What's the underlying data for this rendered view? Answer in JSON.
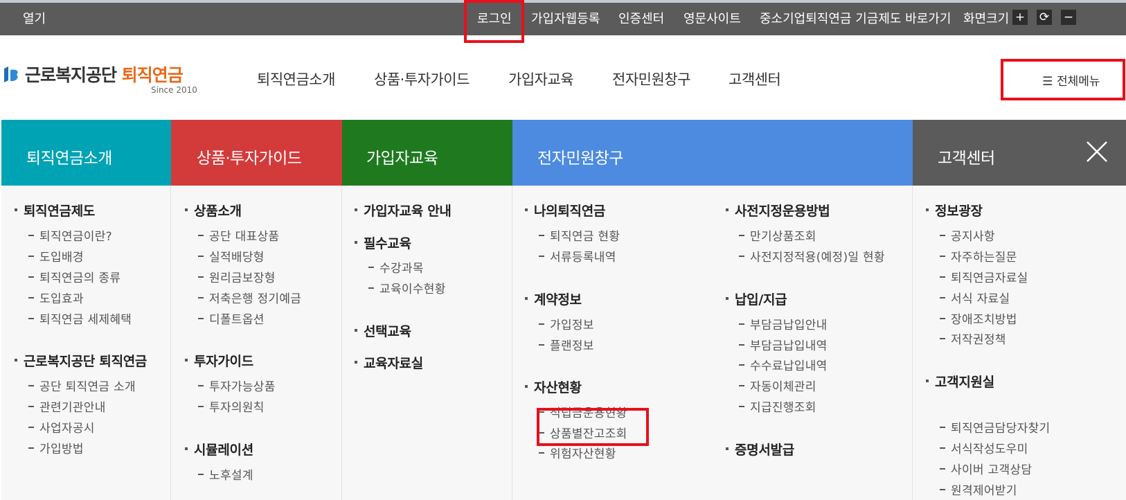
{
  "topbar": {
    "open": "열기",
    "links": [
      "로그인",
      "가입자웹등록",
      "인증센터",
      "영문사이트",
      "중소기업퇴직연금 기금제도 바로가기",
      "화면크기"
    ],
    "zoom_in": "+",
    "zoom_reset": "⟳",
    "zoom_out": "−"
  },
  "header": {
    "logo_main": "근로복지공단 ",
    "logo_accent": "퇴직연금",
    "logo_since": "Since 2010",
    "nav": [
      "퇴직연금소개",
      "상품·투자가이드",
      "가입자교육",
      "전자민원창구",
      "고객센터"
    ],
    "all_menu": "전체메뉴"
  },
  "mega": {
    "columns": [
      {
        "title": "퇴직연금소개",
        "color": "#00a3b4"
      },
      {
        "title": "상품·투자가이드",
        "color": "#d33b3b"
      },
      {
        "title": "가입자교육",
        "color": "#1f7a1f"
      },
      {
        "title": "전자민원창구",
        "color": "#4c8bdf"
      },
      {
        "title": "고객센터",
        "color": "#5b5b5b"
      }
    ],
    "intro": {
      "s1": {
        "title": "퇴직연금제도",
        "items": [
          "퇴직연금이란?",
          "도입배경",
          "퇴직연금의 종류",
          "도입효과",
          "퇴직연금 세제혜택"
        ]
      },
      "s2": {
        "title": "근로복지공단 퇴직연금",
        "items": [
          "공단 퇴직연금 소개",
          "관련기관안내",
          "사업자공시",
          "가입방법"
        ]
      }
    },
    "product": {
      "s1": {
        "title": "상품소개",
        "items": [
          "공단 대표상품",
          "실적배당형",
          "원리금보장형",
          "저축은행 정기예금",
          "디폴트옵션"
        ]
      },
      "s2": {
        "title": "투자가이드",
        "items": [
          "투자가능상품",
          "투자의원칙"
        ]
      },
      "s3": {
        "title": "시뮬레이션",
        "items": [
          "노후설계"
        ]
      }
    },
    "edu": {
      "s1": {
        "title": "가입자교육 안내"
      },
      "s2": {
        "title": "필수교육",
        "items": [
          "수강과목",
          "교육이수현황"
        ]
      },
      "s3": {
        "title": "선택교육"
      },
      "s4": {
        "title": "교육자료실"
      }
    },
    "civil": {
      "s1": {
        "title": "나의퇴직연금",
        "items": [
          "퇴직연금 현황",
          "서류등록내역"
        ]
      },
      "s2": {
        "title": "계약정보",
        "items": [
          "가입정보",
          "플랜정보"
        ]
      },
      "s3": {
        "title": "자산현황",
        "items": [
          "적립금운용현황",
          "상품별잔고조회",
          "위험자산현황"
        ]
      },
      "s4": {
        "title": "사전지정운용방법",
        "items": [
          "만기상품조회",
          "사전지정적용(예정)일 현황"
        ]
      },
      "s5": {
        "title": "납입/지급",
        "items": [
          "부담금납입안내",
          "부담금납입내역",
          "수수료납입내역",
          "자동이체관리",
          "지급진행조회"
        ]
      },
      "s6": {
        "title": "증명서발급"
      }
    },
    "cs": {
      "s1": {
        "title": "정보광장",
        "items": [
          "공지사항",
          "자주하는질문",
          "퇴직연금자료실",
          "서식 자료실",
          "장애조치방법",
          "저작권정책"
        ]
      },
      "s2": {
        "title": "고객지원실",
        "items": [
          "퇴직연금담당자찾기",
          "서식작성도우미",
          "사이버 고객상담",
          "원격제어받기"
        ]
      }
    }
  }
}
